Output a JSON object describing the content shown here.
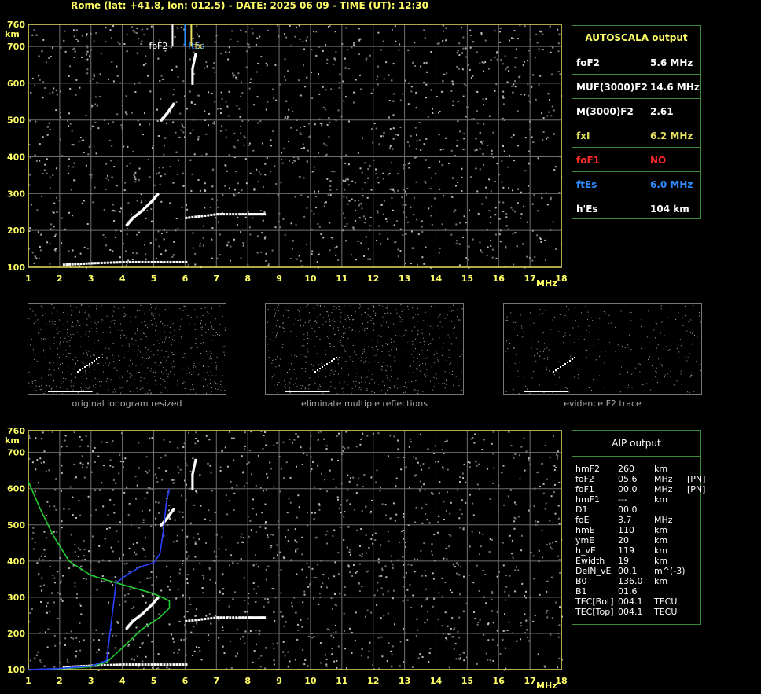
{
  "header": "Rome (lat: +41.8, lon: 012.5) - DATE: 2025 06 09 - TIME (UT): 12:30",
  "autoscala": {
    "title": "AUTOSCALA output",
    "rows": [
      {
        "label": "foF2",
        "value": "5.6 MHz",
        "color": "#ffffff"
      },
      {
        "label": "MUF(3000)F2",
        "value": "14.6 MHz",
        "color": "#ffffff"
      },
      {
        "label": "M(3000)F2",
        "value": "2.61",
        "color": "#ffffff"
      },
      {
        "label": "fxI",
        "value": "6.2 MHz",
        "color": "#e8e060"
      },
      {
        "label": "foF1",
        "value": "NO",
        "color": "#ff2a2a"
      },
      {
        "label": "ftEs",
        "value": "6.0 MHz",
        "color": "#2f8cff"
      },
      {
        "label": "h'Es",
        "value": "104    km",
        "color": "#ffffff"
      }
    ]
  },
  "aip": {
    "title": "AIP output",
    "rows": [
      [
        "hmF2",
        "260",
        "km",
        ""
      ],
      [
        "foF2",
        "05.6",
        "MHz",
        "[PN]"
      ],
      [
        "foF1",
        "00.0",
        "MHz",
        "[PN]"
      ],
      [
        "hmF1",
        "---",
        "km",
        ""
      ],
      [
        "D1",
        "00.0",
        "",
        ""
      ],
      [
        "foE",
        "3.7",
        "MHz",
        ""
      ],
      [
        "hmE",
        "110",
        "km",
        ""
      ],
      [
        "ymE",
        "20",
        "km",
        ""
      ],
      [
        "h_vE",
        "119",
        "km",
        ""
      ],
      [
        "Ewidth",
        "19",
        "km",
        ""
      ],
      [
        "DelN_vE",
        "00.1",
        "m^(-3)",
        ""
      ],
      [
        "B0",
        "136.0",
        "km",
        ""
      ],
      [
        "B1",
        "01.6",
        "",
        ""
      ],
      [
        "TEC[Bot]",
        "004.1",
        "TECU",
        ""
      ],
      [
        "TEC[Top]",
        "004.1",
        "TECU",
        ""
      ]
    ]
  },
  "thumb_captions": [
    "original ionogram resized",
    "eliminate multiple reflections",
    "evidence F2 trace"
  ],
  "chart_data": [
    {
      "type": "scatter",
      "name": "ionogram-autoscala",
      "xlabel": "MHz",
      "ylabel": "km",
      "xlim": [
        1,
        18
      ],
      "ylim": [
        100,
        760
      ],
      "xticks": [
        1,
        2,
        3,
        4,
        5,
        6,
        7,
        8,
        9,
        10,
        11,
        12,
        13,
        14,
        15,
        16,
        17,
        18
      ],
      "yticks": [
        100,
        200,
        300,
        400,
        500,
        600,
        700,
        760
      ],
      "grid": true,
      "markers": [
        {
          "label": "foF2",
          "freq": 5.6,
          "color": "#ffffff"
        },
        {
          "label": "ftEs",
          "freq": 6.0,
          "color": "#2f8cff"
        },
        {
          "label": "fxI",
          "freq": 6.2,
          "color": "#e8e060"
        }
      ],
      "traces": {
        "es_layer": [
          [
            2.1,
            108
          ],
          [
            3,
            112
          ],
          [
            4,
            115
          ],
          [
            5,
            115
          ],
          [
            6,
            115
          ]
        ],
        "f2_lower": [
          [
            4.1,
            215
          ],
          [
            4.3,
            235
          ],
          [
            4.6,
            255
          ],
          [
            4.9,
            280
          ],
          [
            5.1,
            300
          ]
        ],
        "f2_upper": [
          [
            5.2,
            500
          ],
          [
            5.4,
            520
          ],
          [
            5.6,
            545
          ]
        ],
        "x_trace": [
          [
            6.0,
            235
          ],
          [
            7,
            245
          ],
          [
            8,
            245
          ],
          [
            8.5,
            245
          ]
        ],
        "x_vertical": [
          [
            6.2,
            600
          ],
          [
            6.2,
            640
          ],
          [
            6.3,
            680
          ]
        ]
      }
    },
    {
      "type": "line",
      "name": "ionogram-aip",
      "xlabel": "MHz",
      "ylabel": "km",
      "xlim": [
        1,
        18
      ],
      "ylim": [
        100,
        760
      ],
      "xticks": [
        1,
        2,
        3,
        4,
        5,
        6,
        7,
        8,
        9,
        10,
        11,
        12,
        13,
        14,
        15,
        16,
        17,
        18
      ],
      "yticks": [
        100,
        200,
        300,
        400,
        500,
        600,
        700,
        760
      ],
      "grid": true,
      "series": [
        {
          "color": "#22cc33",
          "points": [
            [
              1.0,
              100
            ],
            [
              2.0,
              102
            ],
            [
              3.0,
              108
            ],
            [
              3.5,
              120
            ],
            [
              4.0,
              160
            ],
            [
              4.6,
              210
            ],
            [
              5.2,
              245
            ],
            [
              5.5,
              270
            ],
            [
              5.5,
              290
            ],
            [
              5.0,
              310
            ],
            [
              4.0,
              335
            ],
            [
              3.0,
              360
            ],
            [
              2.3,
              400
            ],
            [
              1.8,
              470
            ],
            [
              1.4,
              540
            ],
            [
              1.0,
              620
            ]
          ]
        },
        {
          "color": "#2a3fff",
          "points": [
            [
              1.0,
              100
            ],
            [
              2.0,
              103
            ],
            [
              3.0,
              110
            ],
            [
              3.5,
              125
            ],
            [
              3.8,
              340
            ],
            [
              4.2,
              365
            ],
            [
              4.6,
              385
            ],
            [
              5.0,
              395
            ],
            [
              5.2,
              420
            ],
            [
              5.3,
              480
            ],
            [
              5.4,
              560
            ],
            [
              5.5,
              600
            ]
          ]
        }
      ],
      "traces": {
        "es_layer": [
          [
            2.1,
            108
          ],
          [
            3,
            112
          ],
          [
            4,
            115
          ],
          [
            5,
            115
          ],
          [
            6,
            115
          ]
        ],
        "f2_lower": [
          [
            4.1,
            215
          ],
          [
            4.3,
            235
          ],
          [
            4.6,
            255
          ],
          [
            4.9,
            280
          ],
          [
            5.1,
            300
          ]
        ],
        "f2_upper": [
          [
            5.2,
            500
          ],
          [
            5.4,
            520
          ],
          [
            5.6,
            545
          ]
        ],
        "x_trace": [
          [
            6.0,
            235
          ],
          [
            7,
            245
          ],
          [
            8,
            245
          ],
          [
            8.5,
            245
          ]
        ],
        "x_vertical": [
          [
            6.2,
            600
          ],
          [
            6.2,
            640
          ],
          [
            6.3,
            680
          ]
        ]
      }
    }
  ]
}
